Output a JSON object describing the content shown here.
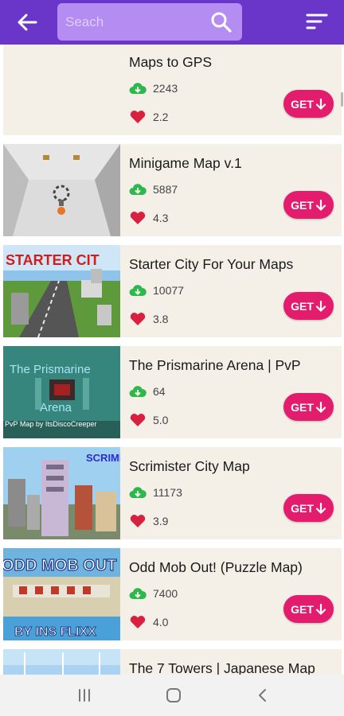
{
  "search": {
    "placeholder": "Seach"
  },
  "colors": {
    "accent": "#6a35c9",
    "search_bg": "#b58cf2",
    "get_button": "#e41c6d",
    "card_bg": "#f4f0e8",
    "download_icon": "#2db84d",
    "heart_icon": "#d8203f"
  },
  "icons": {
    "back": "arrow-left-icon",
    "search": "search-icon",
    "sort": "sort-icon",
    "download": "cloud-download-icon",
    "rating": "heart-icon",
    "get": "arrow-down-icon"
  },
  "items": [
    {
      "title": "Maps to GPS",
      "downloads": "2243",
      "rating": "2.2",
      "get_label": "GET"
    },
    {
      "title": "Minigame Map v.1",
      "downloads": "5887",
      "rating": "4.3",
      "get_label": "GET"
    },
    {
      "title": "Starter City For Your Maps",
      "downloads": "10077",
      "rating": "3.8",
      "get_label": "GET",
      "thumb_text": "STARTER CIT"
    },
    {
      "title": "The Prismarine Arena | PvP",
      "downloads": "64",
      "rating": "5.0",
      "get_label": "GET",
      "thumb_text": "The Prismarine",
      "thumb_text2": "Arena",
      "thumb_text3": "PvP Map by ItsDiscoCreeper"
    },
    {
      "title": "Scrimister City Map",
      "downloads": "11173",
      "rating": "3.9",
      "get_label": "GET",
      "thumb_text": "SCRIMI"
    },
    {
      "title": "Odd Mob Out! (Puzzle Map)",
      "downloads": "7400",
      "rating": "4.0",
      "get_label": "GET",
      "thumb_text": "ODD MOB OUT",
      "thumb_text2": "BY INS FLIXX"
    },
    {
      "title": "The 7 Towers | Japanese Map"
    }
  ]
}
